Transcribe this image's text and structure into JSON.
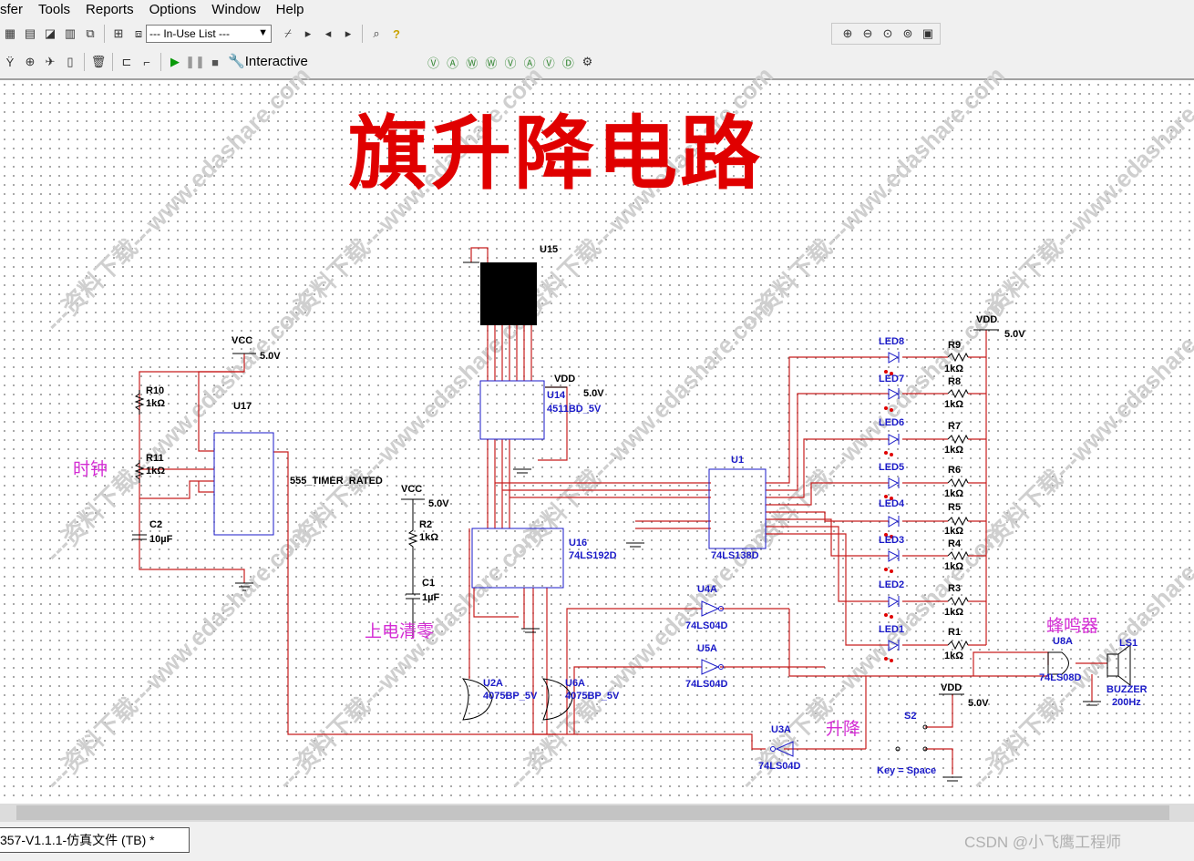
{
  "menu": [
    "sfer",
    "Tools",
    "Reports",
    "Options",
    "Window",
    "Help"
  ],
  "toolbar": {
    "inuse_list": "--- In-Use List ---",
    "interactive_label": "Interactive"
  },
  "watermark_text": "---资料下载---www.edashare.com",
  "schematic": {
    "title": "旗升降电路",
    "annotations": {
      "clock": "时钟",
      "power_on_reset": "上电清零",
      "up_down": "升降",
      "buzzer_cn": "蜂鸣器"
    },
    "labels": {
      "vcc1": "VCC",
      "vcc1_v": "5.0V",
      "r10": "R10",
      "r10_v": "1kΩ",
      "r11": "R11",
      "r11_v": "1kΩ",
      "c2": "C2",
      "c2_v": "10µF",
      "u17": "U17",
      "u17_type": "555_TIMER_RATED",
      "vcc2": "VCC",
      "vcc2_v": "5.0V",
      "r2": "R2",
      "r2_v": "1kΩ",
      "c1": "C1",
      "c1_v": "1µF",
      "u15": "U15",
      "vdd1": "VDD",
      "vdd1_v": "5.0V",
      "u14": "U14",
      "u14_type": "4511BD_5V",
      "u16": "U16",
      "u16_type": "74LS192D",
      "u1": "U1",
      "u1_type": "74LS138D",
      "u2a": "U2A",
      "u2a_type": "4075BP_5V",
      "u6a": "U6A",
      "u6a_type": "4075BP_5V",
      "u4a": "U4A",
      "u4a_type": "74LS04D",
      "u5a": "U5A",
      "u5a_type": "74LS04D",
      "u3a": "U3A",
      "u3a_type": "74LS04D",
      "vdd2": "VDD",
      "vdd2_v": "5.0V",
      "vdd3": "VDD",
      "vdd3_v": "5.0V",
      "s2": "S2",
      "s2_key": "Key = Space",
      "u8a": "U8A",
      "u8a_type": "74LS08D",
      "ls1": "LS1",
      "ls1_type": "BUZZER",
      "ls1_freq": "200Hz"
    },
    "leds": [
      "LED8",
      "LED7",
      "LED6",
      "LED5",
      "LED4",
      "LED3",
      "LED2",
      "LED1"
    ],
    "resistors": [
      {
        "name": "R9",
        "value": "1kΩ"
      },
      {
        "name": "R8",
        "value": "1kΩ"
      },
      {
        "name": "R7",
        "value": "1kΩ"
      },
      {
        "name": "R6",
        "value": "1kΩ"
      },
      {
        "name": "R5",
        "value": "1kΩ"
      },
      {
        "name": "R4",
        "value": "1kΩ"
      },
      {
        "name": "R3",
        "value": "1kΩ"
      },
      {
        "name": "R1",
        "value": "1kΩ"
      }
    ]
  },
  "document_tab": "357-V1.1.1-仿真文件 (TB)  *",
  "credit": "CSDN @小飞鹰工程师"
}
